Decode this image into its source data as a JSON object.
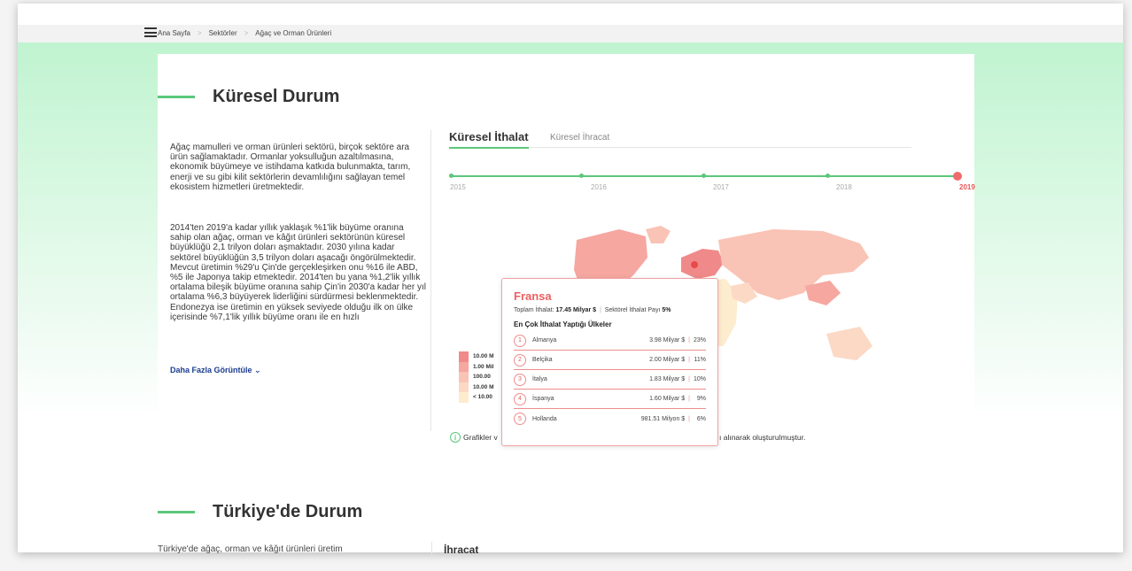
{
  "breadcrumb": {
    "items": [
      "Ana Sayfa",
      "Sektörler",
      "Ağaç ve Orman Ürünleri"
    ],
    "separator": ">"
  },
  "global": {
    "title": "Küresel Durum",
    "paragraph1": "Ağaç mamulleri ve orman ürünleri sektörü, birçok sektöre ara ürün sağlamaktadır. Ormanlar yoksulluğun azaltılmasına, ekonomik büyümeye ve istihdama katkıda bulunmakta, tarım, enerji ve su gibi kilit sektörlerin devamlılığını sağlayan temel ekosistem hizmetleri üretmektedir.",
    "paragraph2": "2014'ten 2019'a kadar yıllık yaklaşık %1'lik büyüme oranına sahip olan ağaç, orman ve kâğıt ürünleri sektörünün küresel büyüklüğü 2,1 trilyon doları aşmaktadır. 2030 yılına kadar sektörel büyüklüğün 3,5 trilyon doları aşacağı öngörülmektedir. Mevcut üretimin %29'u Çin'de gerçekleşirken onu %16 ile ABD, %5 ile Japonya takip etmektedir. 2014'ten bu yana %1,2'lik yıllık ortalama bileşik büyüme oranına sahip Çin'in 2030'a kadar her yıl ortalama %6,3 büyüyerek liderliğini sürdürmesi beklenmektedir. Endonezya ise üretimin en yüksek seviyede olduğu ilk on ülke içerisinde %7,1'lik yıllık büyüme oranı ile en hızlı",
    "more_label": "Daha Fazla Görüntüle",
    "tabs": [
      "Küresel İthalat",
      "Küresel İhracat"
    ],
    "years": [
      "2015",
      "2016",
      "2017",
      "2018",
      "2019"
    ],
    "selected_year": "2019",
    "legend": [
      {
        "label": "10.00 M",
        "color": "#f08a8a"
      },
      {
        "label": "1.00 Mil",
        "color": "#f6a7a0"
      },
      {
        "label": "100.00",
        "color": "#f9c3b5"
      },
      {
        "label": "10.00 M",
        "color": "#fbd9c5"
      },
      {
        "label": "< 10.00",
        "color": "#fdeccd"
      }
    ],
    "note_start": "Grafikler v",
    "note_end": "ı alınarak oluşturulmuştur."
  },
  "tooltip": {
    "country": "Fransa",
    "total_label": "Toplam İthalat:",
    "total_value": "17.45 Milyar $",
    "share_label": "Sektörel İthalat Payı",
    "share_value": "5%",
    "subhead": "En Çok İthalat Yaptığı Ülkeler",
    "rows": [
      {
        "rank": "1",
        "name": "Almanya",
        "value": "3.98 Milyar $",
        "pct": "23%"
      },
      {
        "rank": "2",
        "name": "Belçika",
        "value": "2.00 Milyar $",
        "pct": "11%"
      },
      {
        "rank": "3",
        "name": "İtalya",
        "value": "1.83 Milyar $",
        "pct": "10%"
      },
      {
        "rank": "4",
        "name": "İspanya",
        "value": "1.60 Milyar $",
        "pct": "9%"
      },
      {
        "rank": "5",
        "name": "Hollanda",
        "value": "981.51 Milyon $",
        "pct": "6%"
      }
    ]
  },
  "turkey": {
    "title": "Türkiye'de Durum",
    "text": "Türkiye'de ağaç, orman ve kâğıt ürünleri üretim",
    "export_label": "İhracat"
  }
}
